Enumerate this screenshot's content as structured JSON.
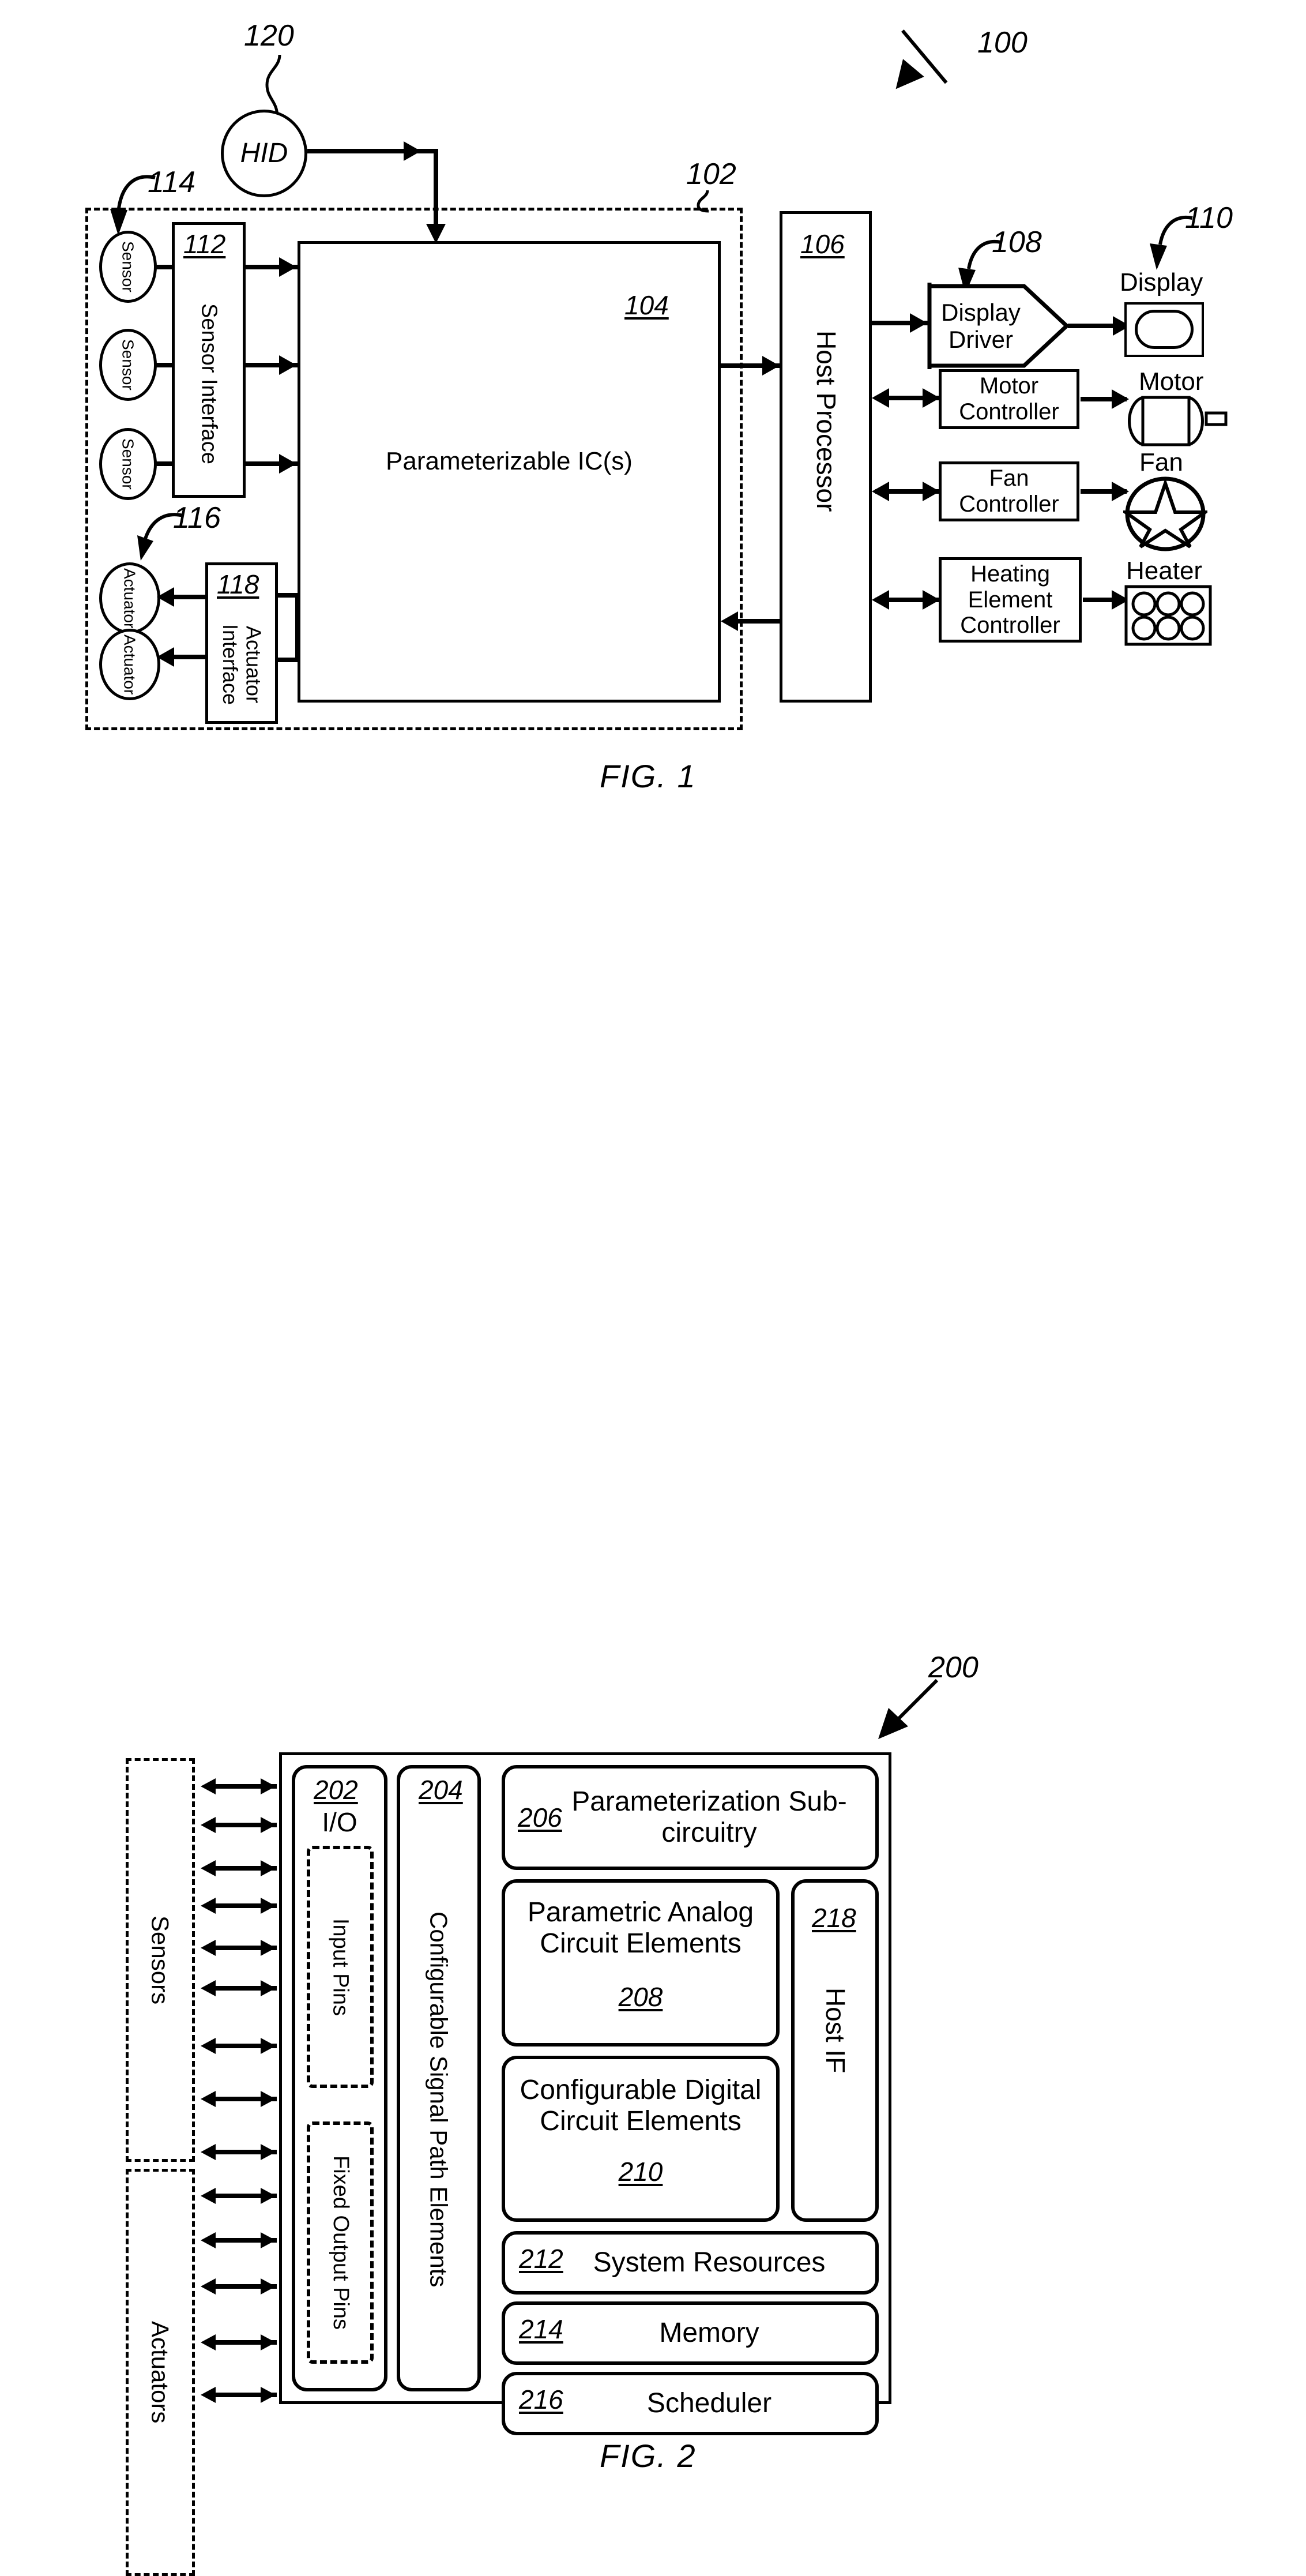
{
  "document": {
    "type": "patent-drawing-sheet",
    "figures": [
      "FIG. 1",
      "FIG. 2"
    ]
  },
  "fig1": {
    "caption": "FIG. 1",
    "system_ref": "100",
    "device_boundary_ref": "102",
    "hid": {
      "label": "HID",
      "ref": "120"
    },
    "sensors_group": {
      "ref": "114",
      "items": [
        "Sensor",
        "Sensor",
        "Sensor"
      ]
    },
    "sensor_interface": {
      "ref": "112",
      "label": "Sensor Interface"
    },
    "actuators_group": {
      "ref": "116",
      "items": [
        "Actuator",
        "Actuator"
      ]
    },
    "actuator_interface": {
      "ref": "118",
      "label": "Actuator Interface"
    },
    "parameterizable_ic": {
      "ref": "104",
      "label": "Parameterizable IC(s)"
    },
    "host_processor": {
      "ref": "106",
      "label": "Host Processor"
    },
    "display_driver": {
      "ref": "108",
      "label": "Display Driver"
    },
    "display": {
      "ref": "110",
      "label": "Display"
    },
    "motor_controller": {
      "label": "Motor Controller"
    },
    "motor": {
      "label": "Motor"
    },
    "fan_controller": {
      "label": "Fan Controller"
    },
    "fan": {
      "label": "Fan"
    },
    "heating_element_controller": {
      "label": "Heating Element Controller"
    },
    "heater": {
      "label": "Heater"
    }
  },
  "fig2": {
    "caption": "FIG. 2",
    "system_ref": "200",
    "sensors_label": "Sensors",
    "actuators_label": "Actuators",
    "io": {
      "ref": "202",
      "label": "I/O"
    },
    "input_pins": {
      "label": "Input Pins"
    },
    "fixed_output_pins": {
      "label": "Fixed Output Pins"
    },
    "signal_path": {
      "ref": "204",
      "label": "Configurable Signal Path Elements"
    },
    "parameterization": {
      "ref": "206",
      "label": "Parameterization Sub-circuitry"
    },
    "analog_elements": {
      "ref": "208",
      "label": "Parametric Analog Circuit Elements"
    },
    "digital_elements": {
      "ref": "210",
      "label": "Configurable Digital Circuit Elements"
    },
    "system_resources": {
      "ref": "212",
      "label": "System Resources"
    },
    "memory": {
      "ref": "214",
      "label": "Memory"
    },
    "scheduler": {
      "ref": "216",
      "label": "Scheduler"
    },
    "host_if": {
      "ref": "218",
      "label": "Host IF"
    }
  }
}
